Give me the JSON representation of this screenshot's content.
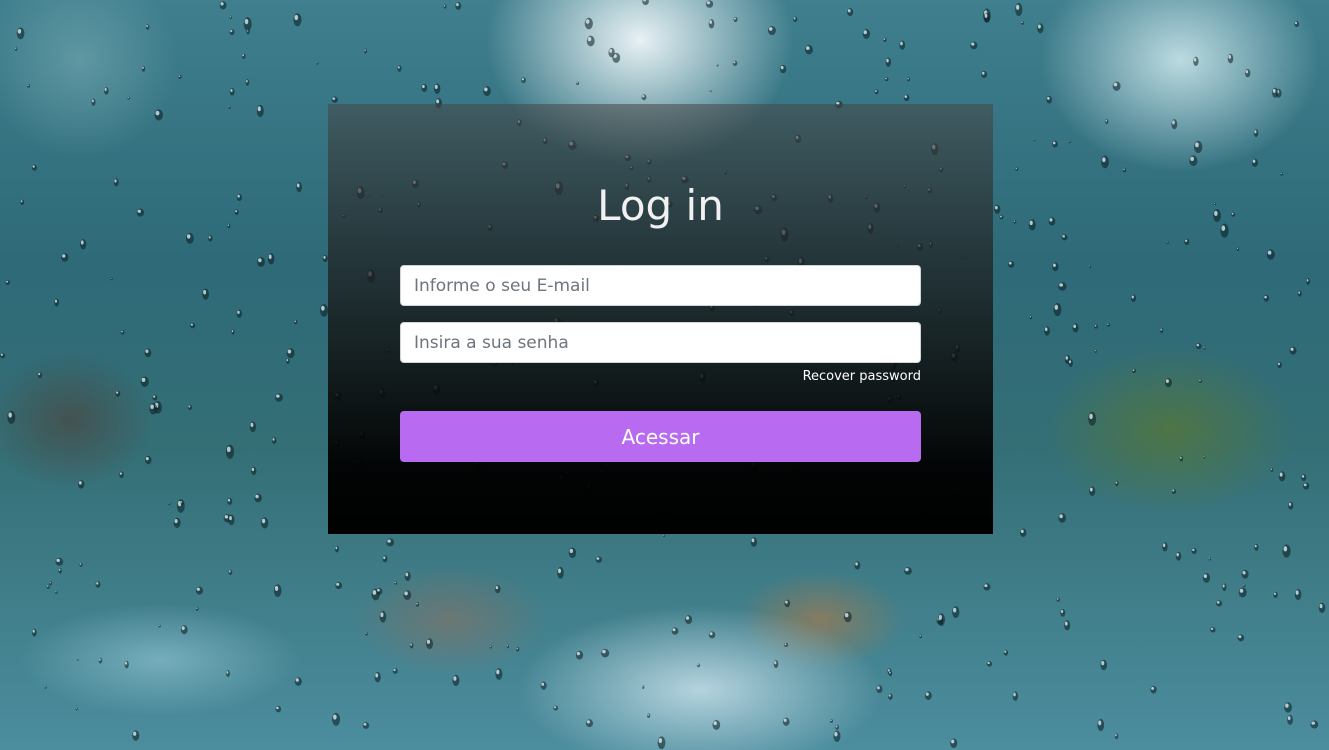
{
  "login": {
    "title": "Log in",
    "email_placeholder": "Informe o seu E-mail",
    "password_placeholder": "Insira a sua senha",
    "recover_label": "Recover password",
    "submit_label": "Acessar"
  },
  "colors": {
    "submit_button": "#b86af0",
    "panel": "#000000",
    "title_text": "#f1f1f1"
  }
}
